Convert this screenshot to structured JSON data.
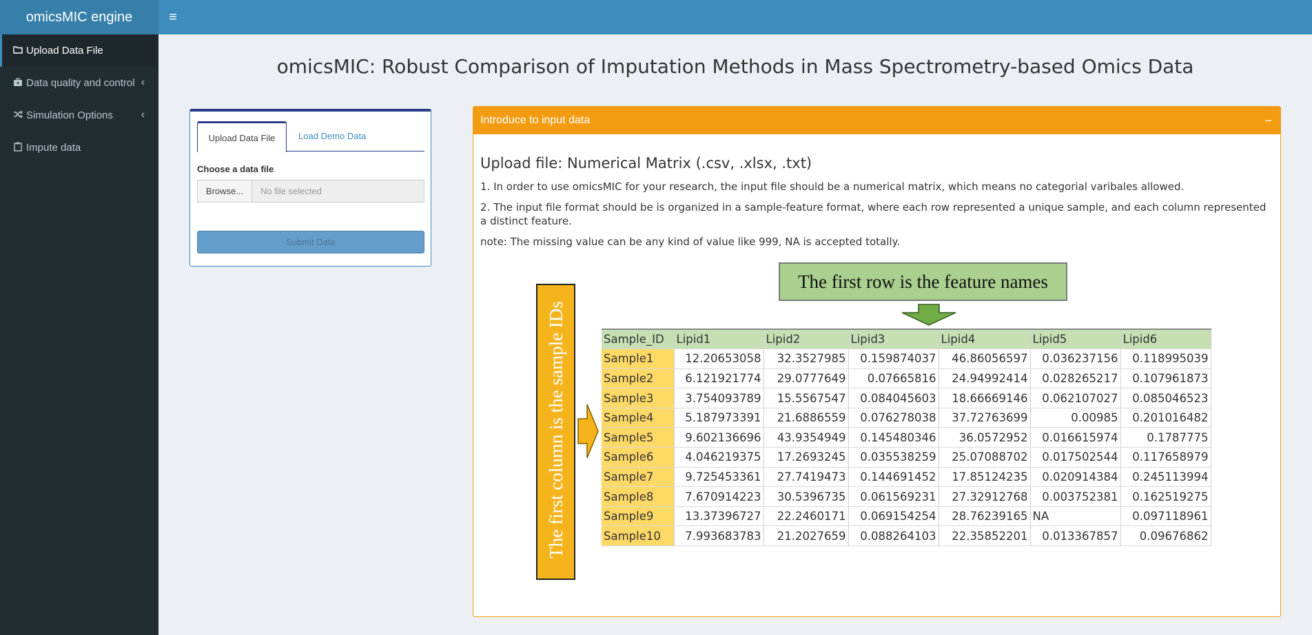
{
  "app": {
    "title": "omicsMIC engine"
  },
  "header": {
    "menu_icon": "hamburger-icon"
  },
  "sidebar": {
    "items": [
      {
        "label": "Upload Data File",
        "icon": "folder-icon"
      },
      {
        "label": "Data quality and control",
        "icon": "toolbox-icon"
      },
      {
        "label": "Simulation Options",
        "icon": "shuffle-icon"
      },
      {
        "label": "Impute data",
        "icon": "clipboard-icon"
      }
    ]
  },
  "main": {
    "title": "omicsMIC: Robust Comparison of Imputation Methods in Mass Spectrometry-based Omics Data",
    "upload_box": {
      "tabs": [
        "Upload Data File",
        "Load Demo Data"
      ],
      "choose_label": "Choose a data file",
      "browse_label": "Browse...",
      "file_placeholder": "No file selected",
      "submit_label": "Submit Data"
    },
    "intro_box": {
      "header": "Introduce to input data",
      "collapse_label": "−",
      "subhead": "Upload file: Numerical Matrix (.csv, .xlsx, .txt)",
      "p1": "1. In order to use omicsMIC for your research, the input file should be a numerical matrix, which means no categorial varibales allowed.",
      "p2": "2. The input file format should be is organized in a sample-feature format, where each row represented a unique sample, and each column represented a distinct feature.",
      "p3": "note: The missing value can be any kind of value like 999, NA is accepted totally.",
      "diagram": {
        "feature_label": "The first row is the feature names",
        "sample_label": "The first column is the sample IDs",
        "table": {
          "headers": [
            "Sample_ID",
            "Lipid1",
            "Lipid2",
            "Lipid3",
            "Lipid4",
            "Lipid5",
            "Lipid6"
          ],
          "rows": [
            [
              "Sample1",
              "12.20653058",
              "32.3527985",
              "0.159874037",
              "46.86056597",
              "0.036237156",
              "0.118995039"
            ],
            [
              "Sample2",
              "6.121921774",
              "29.0777649",
              "0.07665816",
              "24.94992414",
              "0.028265217",
              "0.107961873"
            ],
            [
              "Sample3",
              "3.754093789",
              "15.5567547",
              "0.084045603",
              "18.66669146",
              "0.062107027",
              "0.085046523"
            ],
            [
              "Sample4",
              "5.187973391",
              "21.6886559",
              "0.076278038",
              "37.72763699",
              "0.00985",
              "0.201016482"
            ],
            [
              "Sample5",
              "9.602136696",
              "43.9354949",
              "0.145480346",
              "36.0572952",
              "0.016615974",
              "0.1787775"
            ],
            [
              "Sample6",
              "4.046219375",
              "17.2693245",
              "0.035538259",
              "25.07088702",
              "0.017502544",
              "0.117658979"
            ],
            [
              "Sample7",
              "9.725453361",
              "27.7419473",
              "0.144691452",
              "17.85124235",
              "0.020914384",
              "0.245113994"
            ],
            [
              "Sample8",
              "7.670914223",
              "30.5396735",
              "0.061569231",
              "27.32912768",
              "0.003752381",
              "0.162519275"
            ],
            [
              "Sample9",
              "13.37396727",
              "22.2460171",
              "0.069154254",
              "28.76239165",
              "NA",
              "0.097118961"
            ],
            [
              "Sample10",
              "7.993683783",
              "21.2027659",
              "0.088264103",
              "22.35852201",
              "0.013367857",
              "0.09676862"
            ]
          ]
        }
      }
    }
  }
}
